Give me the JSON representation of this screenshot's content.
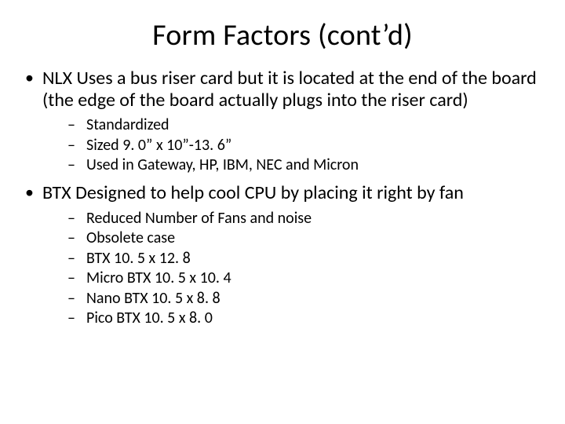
{
  "title": "Form Factors (cont’d)",
  "bullets": [
    {
      "text": "NLX Uses a bus riser card but it is located at the end of the board (the edge of the board actually plugs into the riser card)",
      "sub": [
        "Standardized",
        "Sized 9. 0” x 10”-13. 6”",
        "Used in Gateway, HP, IBM, NEC and Micron"
      ]
    },
    {
      "text": "BTX  Designed to help cool CPU by placing it right by fan",
      "sub": [
        "Reduced Number of Fans and noise",
        "Obsolete case",
        "BTX 10. 5 x 12. 8",
        "Micro BTX 10. 5 x 10. 4",
        "Nano BTX 10. 5 x 8. 8",
        "Pico BTX 10. 5 x 8. 0"
      ]
    }
  ]
}
